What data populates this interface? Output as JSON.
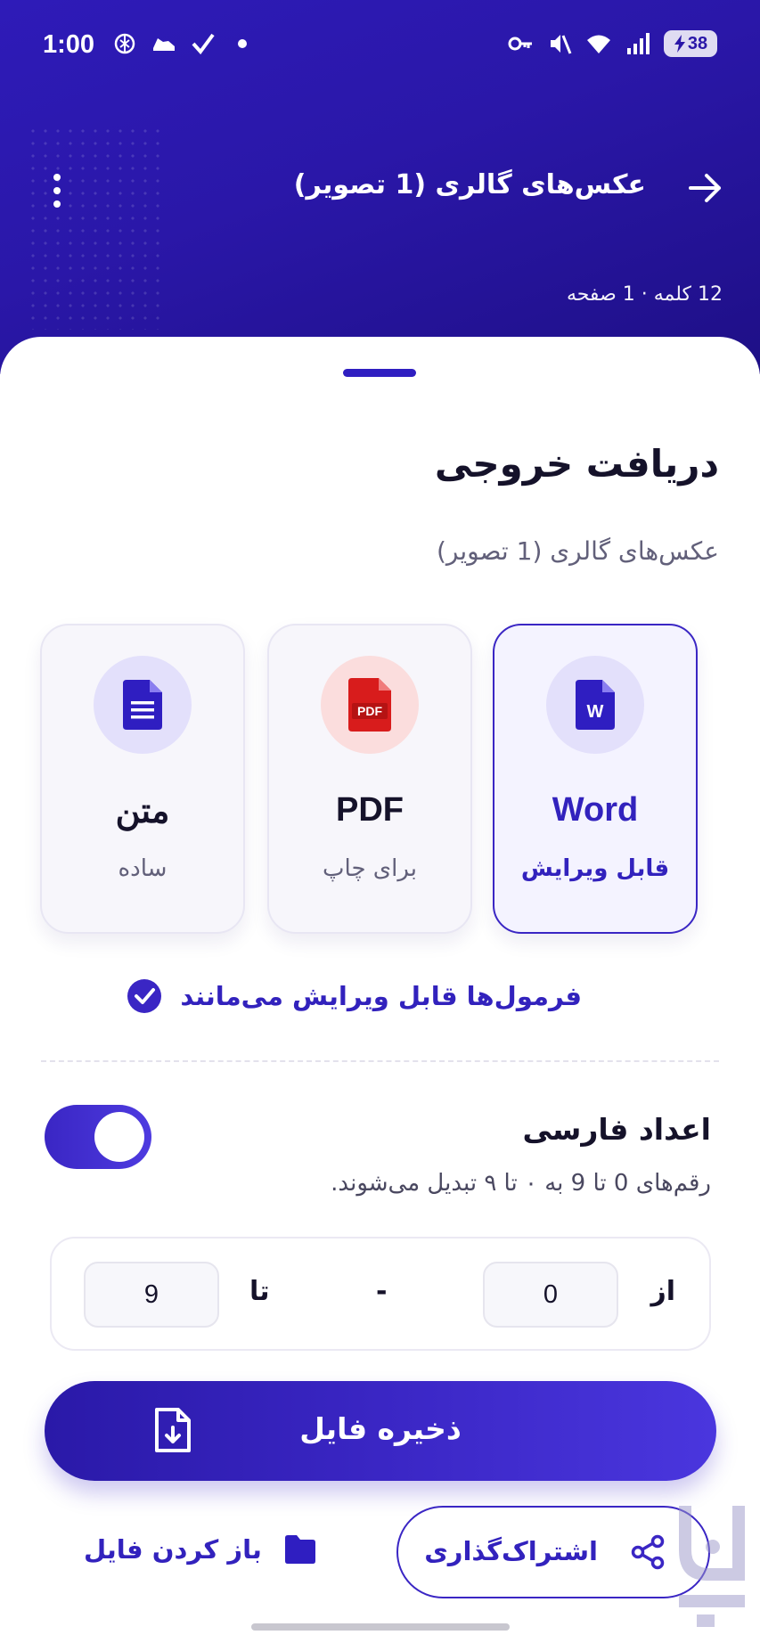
{
  "status_bar": {
    "time": "1:00",
    "battery": "38"
  },
  "header": {
    "title": "عکس‌های گالری (1 تصویر)",
    "meta": "12 کلمه · 1 صفحه"
  },
  "sheet": {
    "title": "دریافت خروجی",
    "subtitle": "عکس‌های گالری (1 تصویر)"
  },
  "formats": [
    {
      "title": "Word",
      "subtitle": "قابل ویرایش",
      "icon": "word-file-icon",
      "selected": true
    },
    {
      "title": "PDF",
      "subtitle": "برای چاپ",
      "icon": "pdf-file-icon",
      "selected": false
    },
    {
      "title": "متن",
      "subtitle": "ساده",
      "icon": "text-file-icon",
      "selected": false
    }
  ],
  "icon_labels": {
    "word": "W",
    "pdf": "PDF"
  },
  "formula_note": "فرمول‌ها قابل ویرایش می‌مانند",
  "farsi_numbers": {
    "title": "اعداد فارسی",
    "description": "رقم‌های 0 تا 9 به ۰ تا ۹ تبدیل می‌شوند.",
    "enabled": true
  },
  "range": {
    "from_label": "از",
    "from_value": "0",
    "dash": "-",
    "to_label": "تا",
    "to_value": "9"
  },
  "actions": {
    "save": "ذخیره فایل",
    "share": "اشتراک‌گذاری",
    "open": "باز کردن فایل"
  },
  "colors": {
    "primary": "#3a26c4",
    "header_bg": "#2a17a8",
    "pdf_red": "#d81c1c"
  }
}
